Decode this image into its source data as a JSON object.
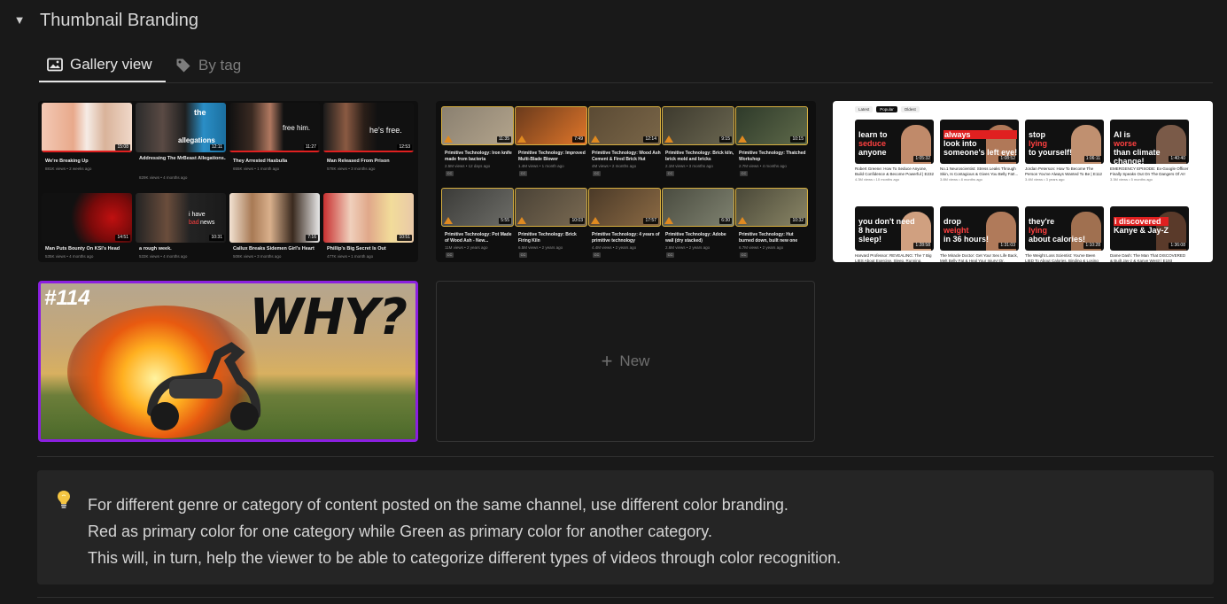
{
  "toggle": {
    "arrow": "▼",
    "title": "Thumbnail Branding"
  },
  "tabs": [
    {
      "label": "Gallery view",
      "icon": "image-icon",
      "active": true
    },
    {
      "label": "By tag",
      "icon": "tag-icon",
      "active": false
    }
  ],
  "card1": {
    "tiles": [
      {
        "title": "We're Breaking Up",
        "meta": "881K views • 2 weeks ago",
        "duration": "15:08"
      },
      {
        "title": "Addressing The MrBeast Allegations...",
        "meta": "829K views • 4 months ago",
        "duration": "12:11",
        "overlay_a": "the",
        "overlay_b": "allegations"
      },
      {
        "title": "They Arrested Hasbulla",
        "meta": "655K views • 1 month ago",
        "duration": "11:27",
        "overlay": "free him."
      },
      {
        "title": "Man Released From Prison",
        "meta": "578K views • 3 months ago",
        "duration": "12:53",
        "overlay": "he's free."
      },
      {
        "title": "Man Puts Bounty On KSI's Head",
        "meta": "535K views • 4 months ago",
        "duration": "14:51"
      },
      {
        "title": "a rough week.",
        "meta": "533K views • 4 months ago",
        "duration": "10:31",
        "overlay_a": "i have",
        "overlay_b": "bad",
        "overlay_c": "news"
      },
      {
        "title": "Callux Breaks Sidemen Girl's Heart",
        "meta": "508K views • 3 months ago",
        "duration": "7:16"
      },
      {
        "title": "Phillip's Big Secret Is Out",
        "meta": "477K views • 1 month ago",
        "duration": "10:51"
      }
    ]
  },
  "card2": {
    "tiles": [
      {
        "title": "Primitive Technology: Iron knife made from bacteria",
        "meta": "2.5M views • 12 days ago",
        "duration": "11:35"
      },
      {
        "title": "Primitive Technology: Improved Multi-Blade Blower",
        "meta": "1.4M views • 1 month ago",
        "duration": "7:49"
      },
      {
        "title": "Primitive Technology: Wood Ash Cement & Fired Brick Hut",
        "meta": "4M views • 2 months ago",
        "duration": "12:14"
      },
      {
        "title": "Primitive Technology: Brick kiln, brick mold and bricks",
        "meta": "2.1M views • 3 months ago",
        "duration": "9:15"
      },
      {
        "title": "Primitive Technology: Thatched Workshop",
        "meta": "2.7M views • 4 months ago",
        "duration": "10:15"
      },
      {
        "title": "Primitive Technology: Pot Made of Wood Ash - New...",
        "meta": "11M views • 2 years ago",
        "duration": "5:55"
      },
      {
        "title": "Primitive Technology: Brick Firing Kiln",
        "meta": "6.5M views • 2 years ago",
        "duration": "10:03"
      },
      {
        "title": "Primitive Technology: 4 years of primitive technology",
        "meta": "4.4M views • 2 years ago",
        "duration": "17:57"
      },
      {
        "title": "Primitive Technology: Adobe wall (dry stacked)",
        "meta": "2.6M views • 2 years ago",
        "duration": "6:30"
      },
      {
        "title": "Primitive Technology: Hut burned down, built new one",
        "meta": "6.7M views • 2 years ago",
        "duration": "10:32"
      }
    ],
    "cc": "CC"
  },
  "card3": {
    "tabs": [
      "Latest",
      "Popular",
      "Oldest"
    ],
    "tiles": [
      {
        "line1": "learn to",
        "line2": "seduce",
        "line3": "anyone",
        "title": "Robert Greene: How To Seduce Anyone, Build Confidence & Become Powerful | E232",
        "meta": "4.3M views • 10 months ago"
      },
      {
        "line1": "always",
        "line2": "look into",
        "line3": "someone's left eye!",
        "title": "No.1 Neuroscientist: Stress Leaks Through Skin, Is Contagious & Gives You Belly Fat!...",
        "meta": "3.8M views • 8 months ago"
      },
      {
        "line1": "stop",
        "line2": "lying",
        "line3": "to yourself!",
        "title": "Jordan Peterson: How To Become The Person You've Always Wanted To Be | E112",
        "meta": "3.4M views • 3 years ago"
      },
      {
        "line1": "AI is",
        "line2": "worse",
        "line3": "than climate change!",
        "title": "EMERGENCY EPISODE: Ex-Google Officer Finally Speaks Out On The Dangers Of AI! -...",
        "meta": "3.3M views • 5 months ago"
      },
      {
        "line1": "you don't need",
        "line2": "8 hours",
        "line3": "sleep!",
        "title": "Harvard Professor: REVEALING: The 7 Big LIES About Exercise, Sleep, Running, Carb...",
        "meta": "3.0M views • 1 year ago"
      },
      {
        "line1": "drop",
        "line2": "weight",
        "line3": "in 36 hours!",
        "title": "The Miracle Doctor: Get Your Sex Life Back, Melt Belly Fat & Heal Your Injury! Dr. Mindy...",
        "meta": "2.8M views • 1 year ago"
      },
      {
        "line1": "they're",
        "line2": "lying",
        "line3": "about calories!",
        "title": "The Weight Loss Scientist: You've Been LIED To About Calories, Binding & Losing Weight...",
        "meta": "2.6M views • 1 year ago"
      },
      {
        "line1": "i discovered",
        "line2": "Kanye & Jay-Z",
        "line3": "",
        "title": "Dame Dash: The Man That DISCOVERED & Built Jay-z & Kanye West! | E193",
        "meta": "2.4M views • 2 years ago"
      }
    ],
    "durations": [
      "1:05:32",
      "1:08:52",
      "1:06:11",
      "1:40:40",
      "1:28:58",
      "1:31:03",
      "1:10:28",
      "1:36:08"
    ]
  },
  "card4": {
    "badge": "#114",
    "headline": "WHY?"
  },
  "new_card": {
    "plus": "+",
    "label": "New"
  },
  "callout": {
    "icon": "lightbulb-icon",
    "lines": [
      "For different genre or category of content posted on the same channel, use different color branding.",
      "Red as primary color for one category while Green as primary color for another category.",
      "This will, in turn, help the viewer to be able to categorize different types of videos through color recognition."
    ]
  }
}
